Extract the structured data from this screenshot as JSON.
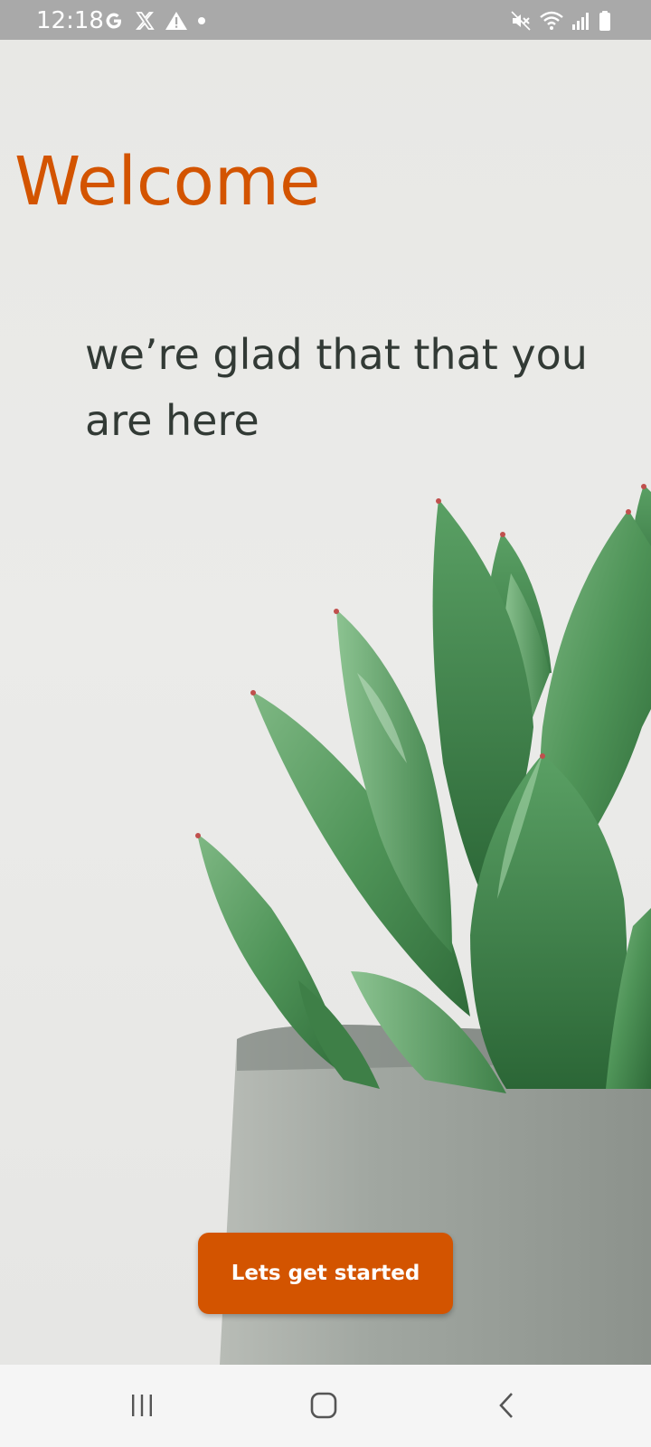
{
  "status_bar": {
    "time": "12:18",
    "left_icons": [
      "google-icon",
      "x-icon",
      "warning-icon",
      "dot-icon"
    ],
    "right_icons": [
      "mute-icon",
      "wifi-icon",
      "signal-icon",
      "battery-icon"
    ]
  },
  "welcome": {
    "title": "Welcome",
    "subtitle": "we’re glad that that you are here",
    "cta_label": "Lets get started"
  },
  "nav_bar": {
    "buttons": [
      "recents-button",
      "home-button",
      "back-button"
    ]
  },
  "colors": {
    "accent": "#d35400",
    "subtitle": "#323a35",
    "status_bar": "#a9a9a9"
  }
}
